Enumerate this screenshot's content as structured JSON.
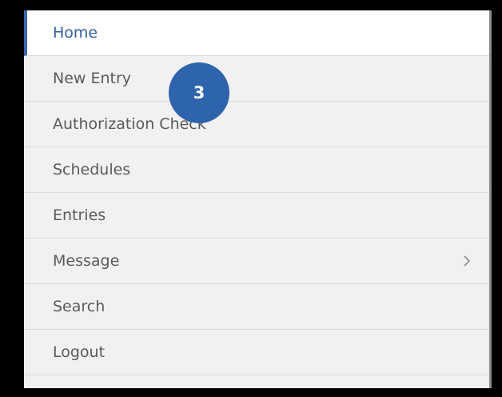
{
  "menu": {
    "items": [
      {
        "label": "Home",
        "active": true
      },
      {
        "label": "New Entry"
      },
      {
        "label": "Authorization Check"
      },
      {
        "label": "Schedules"
      },
      {
        "label": "Entries"
      },
      {
        "label": "Message",
        "icon": "chevron-right-icon"
      },
      {
        "label": "Search"
      },
      {
        "label": "Logout"
      }
    ]
  },
  "badge": {
    "text": "3"
  },
  "colors": {
    "accent": "#3a66b5",
    "active_text": "#2f5fa3",
    "badge": "#2e64ac",
    "menu_bg": "#f1f1f1",
    "text": "#5a5a5a"
  }
}
